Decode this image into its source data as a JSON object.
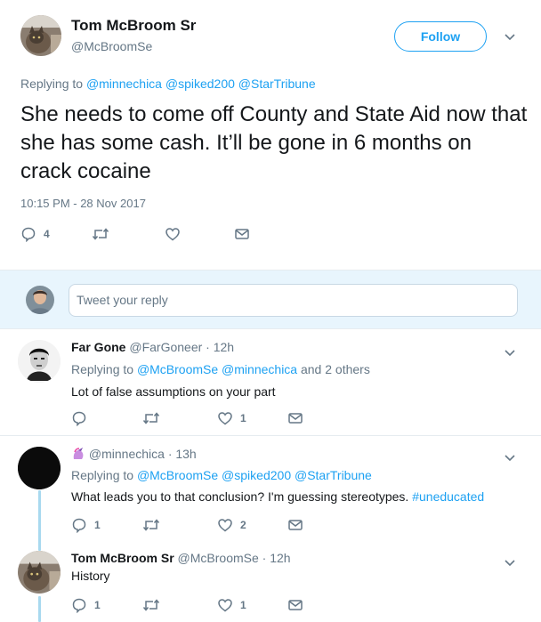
{
  "main_tweet": {
    "name": "Tom McBroom Sr",
    "handle": "@McBroomSe",
    "follow_label": "Follow",
    "replying_prefix": "Replying to",
    "replying_mentions": "@minnechica @spiked200 @StarTribune",
    "text": "She needs to come off County and State Aid now that she has some cash. It’ll be gone in 6 months on crack cocaine",
    "timestamp": "10:15 PM - 28 Nov 2017",
    "reply_count": "4",
    "retweet_count": "",
    "like_count": ""
  },
  "composer": {
    "placeholder": "Tweet your reply"
  },
  "replies": [
    {
      "name": "Far Gone",
      "handle": "@FarGoneer",
      "time": "· 12h",
      "replying_prefix": "Replying to",
      "replying_mentions": "@McBroomSe @minnechica",
      "replying_suffix": "and 2 others",
      "text": "Lot of false assumptions on your part",
      "reply_count": "",
      "retweet_count": "",
      "like_count": "1"
    },
    {
      "name": "",
      "handle": "@minnechica",
      "time": "· 13h",
      "replying_prefix": "Replying to",
      "replying_mentions": "@McBroomSe @spiked200 @StarTribune",
      "text": "What leads you to that conclusion? I'm guessing stereotypes.",
      "hashtag": "#uneducated",
      "reply_count": "1",
      "retweet_count": "",
      "like_count": "2"
    },
    {
      "name": "Tom McBroom Sr",
      "handle": "@McBroomSe",
      "time": "· 12h",
      "text": "History",
      "reply_count": "1",
      "retweet_count": "",
      "like_count": "1"
    }
  ],
  "icons": {
    "reply": "reply-icon",
    "retweet": "retweet-icon",
    "like": "heart-icon",
    "dm": "envelope-icon",
    "caret": "chevron-down-icon",
    "unicorn": "unicorn-emoji-icon"
  },
  "colors": {
    "accent": "#1da1f2",
    "muted": "#657786",
    "thread_line": "#a8d9ef",
    "composer_bg": "#e8f5fd"
  }
}
